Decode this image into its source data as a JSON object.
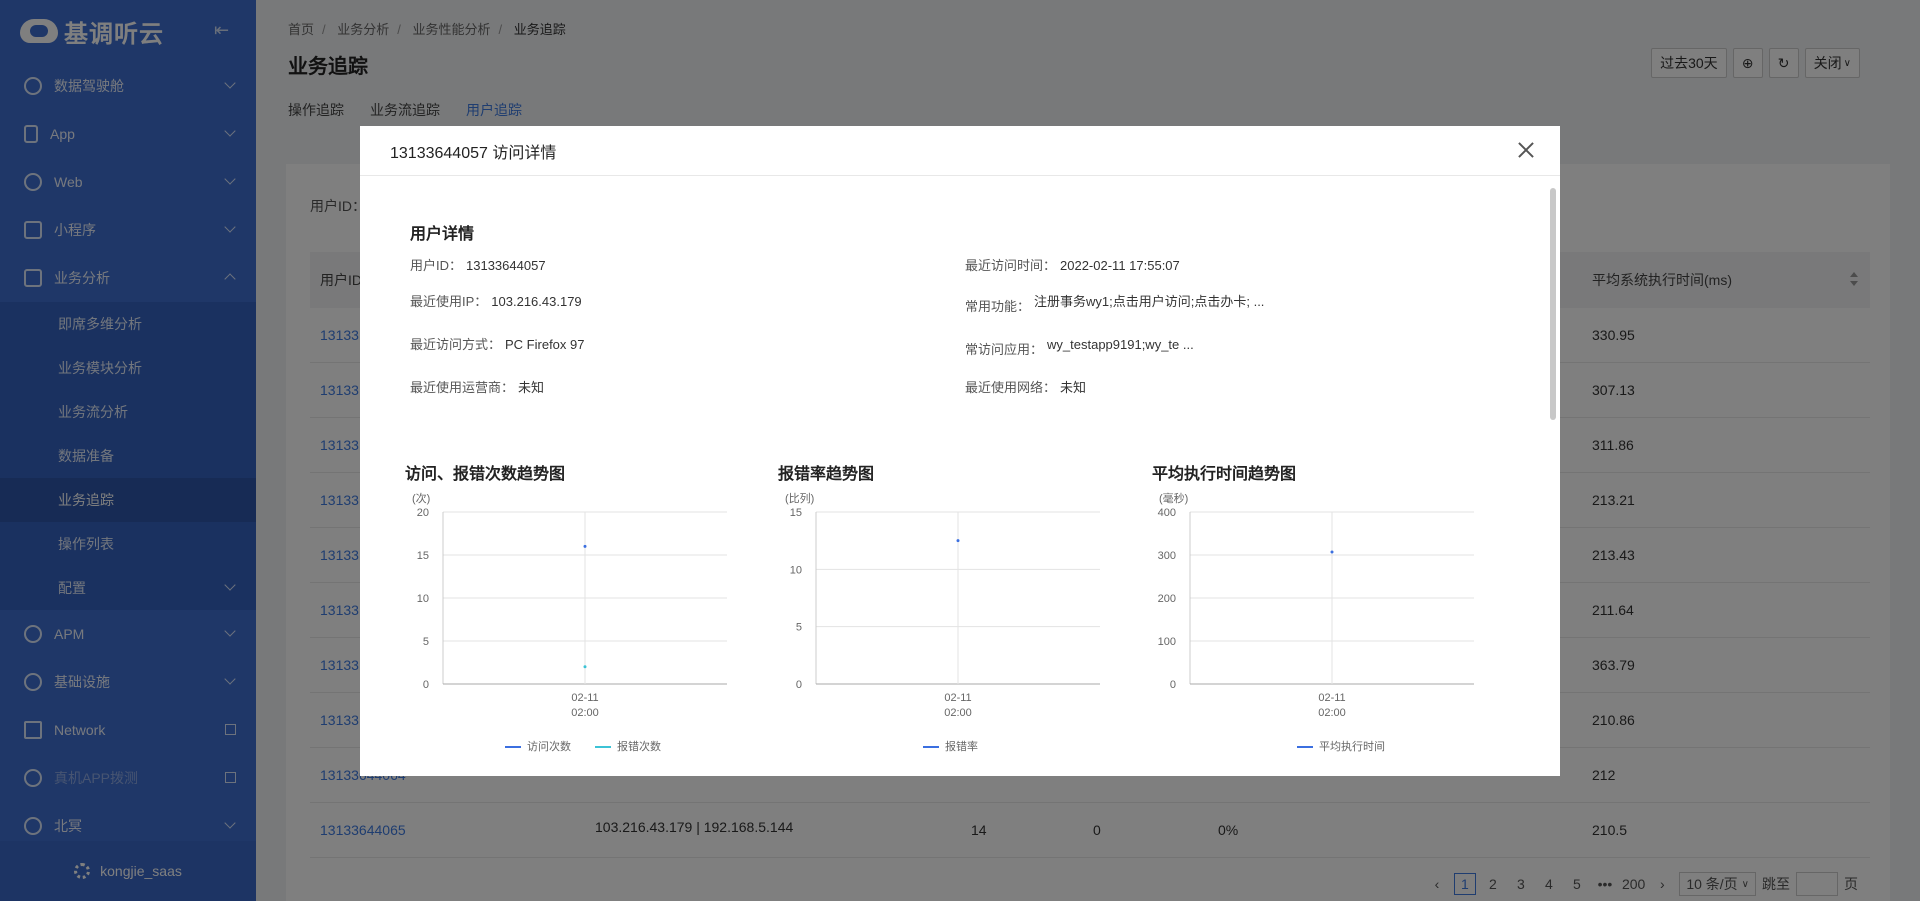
{
  "sidebar": {
    "logo_text": "基调听云",
    "menu": [
      {
        "label": "数据驾驶舱"
      },
      {
        "label": "App"
      },
      {
        "label": "Web"
      },
      {
        "label": "小程序"
      },
      {
        "label": "业务分析"
      }
    ],
    "submenu": [
      {
        "label": "即席多维分析"
      },
      {
        "label": "业务模块分析"
      },
      {
        "label": "业务流分析"
      },
      {
        "label": "数据准备"
      },
      {
        "label": "业务追踪"
      },
      {
        "label": "操作列表"
      },
      {
        "label": "配置"
      }
    ],
    "menu_bottom": [
      {
        "label": "APM"
      },
      {
        "label": "基础设施"
      },
      {
        "label": "Network"
      },
      {
        "label": "真机APP拨测"
      },
      {
        "label": "北冥"
      }
    ],
    "user": "kongjie_saas"
  },
  "breadcrumb": [
    "首页",
    "业务分析",
    "业务性能分析",
    "业务追踪"
  ],
  "page_title": "业务追踪",
  "toolbar": {
    "range": "过去30天",
    "close": "关闭"
  },
  "tabs": [
    "操作追踪",
    "业务流追踪",
    "用户追踪"
  ],
  "table": {
    "filter_label": "用户ID：",
    "col_first": "用户ID",
    "col_last": "平均系统执行时间(ms)",
    "rows": [
      {
        "id": "13133",
        "avg": "330.95"
      },
      {
        "id": "13133",
        "avg": "307.13"
      },
      {
        "id": "13133",
        "avg": "311.86"
      },
      {
        "id": "13133",
        "avg": "213.21"
      },
      {
        "id": "13133",
        "avg": "213.43"
      },
      {
        "id": "13133",
        "avg": "211.64"
      },
      {
        "id": "13133",
        "avg": "363.79"
      },
      {
        "id": "13133",
        "avg": "210.86"
      },
      {
        "id": "13133644064",
        "avg": "212"
      }
    ],
    "last_row": {
      "id": "13133644065",
      "ip": "103.216.43.179 | 192.168.5.144",
      "visits": "14",
      "errors": "0",
      "rate": "0%",
      "avg": "210.5"
    }
  },
  "pager": {
    "pages": [
      "1",
      "2",
      "3",
      "4",
      "5",
      "•••",
      "200"
    ],
    "size": "10 条/页",
    "jump": "跳至",
    "page_unit": "页"
  },
  "modal": {
    "title": "13133644057 访问详情",
    "section": "用户详情",
    "fields": {
      "user_id_label": "用户ID：",
      "user_id": "13133644057",
      "last_time_label": "最近访问时间：",
      "last_time": "2022-02-11 17:55:07",
      "ip_label": "最近使用IP：",
      "ip": "103.216.43.179",
      "func_label": "常用功能：",
      "func": "注册事务wy1;点击用户访问;点击办卡; ...",
      "mode_label": "最近访问方式：",
      "mode": "PC Firefox 97",
      "app_label": "常访问应用：",
      "app": "wy_testapp9191;wy_te ...",
      "isp_label": "最近使用运营商：",
      "isp": "未知",
      "net_label": "最近使用网络：",
      "net": "未知"
    }
  },
  "chart_data": [
    {
      "type": "line",
      "title": "访问、报错次数趋势图",
      "ylabel": "(次)",
      "ylim": [
        0,
        20
      ],
      "yticks": [
        "0",
        "5",
        "10",
        "15",
        "20"
      ],
      "x": [
        "02-11 02:00"
      ],
      "series": [
        {
          "name": "访问次数",
          "values": [
            16
          ],
          "color": "#3b6fe0"
        },
        {
          "name": "报错次数",
          "values": [
            2
          ],
          "color": "#3cc3d6"
        }
      ]
    },
    {
      "type": "line",
      "title": "报错率趋势图",
      "ylabel": "(比列)",
      "ylim": [
        0,
        15
      ],
      "yticks": [
        "0",
        "5",
        "10",
        "15"
      ],
      "x": [
        "02-11 02:00"
      ],
      "series": [
        {
          "name": "报错率",
          "values": [
            12.5
          ],
          "color": "#3b6fe0"
        }
      ]
    },
    {
      "type": "line",
      "title": "平均执行时间趋势图",
      "ylabel": "(毫秒)",
      "ylim": [
        0,
        400
      ],
      "yticks": [
        "0",
        "100",
        "200",
        "300",
        "400"
      ],
      "x": [
        "02-11 02:00"
      ],
      "series": [
        {
          "name": "平均执行时间",
          "values": [
            307
          ],
          "color": "#3b6fe0"
        }
      ]
    }
  ]
}
